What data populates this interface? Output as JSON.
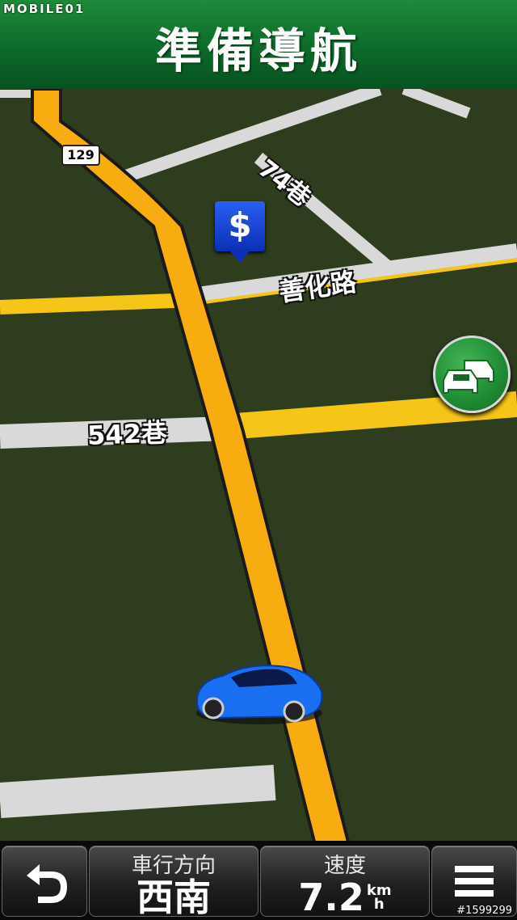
{
  "watermark": "MOBILE01",
  "header": {
    "title": "準備導航"
  },
  "map": {
    "route_number": "129",
    "roads": {
      "lane_74": "74巷",
      "shanhua_road": "善化路",
      "lane_542": "542巷"
    },
    "poi_symbol": "$",
    "traffic_icon": "traffic-cars-icon",
    "vehicle_icon": "blue-car-icon",
    "colors": {
      "ground": "#2e3d1d",
      "route": "#f7ac0f",
      "minor_road": "#d9d9d9",
      "yellow_road": "#f5c518",
      "poi": "#1a3fd6",
      "traffic": "#2a9a3c"
    }
  },
  "bottom": {
    "back_icon": "back-arrow-icon",
    "heading": {
      "label": "車行方向",
      "value": "西南"
    },
    "speed": {
      "label": "速度",
      "value": "7.2",
      "unit_top": "km",
      "unit_bottom": "h"
    },
    "menu_icon": "menu-icon"
  },
  "footer_tag": "#1599299"
}
